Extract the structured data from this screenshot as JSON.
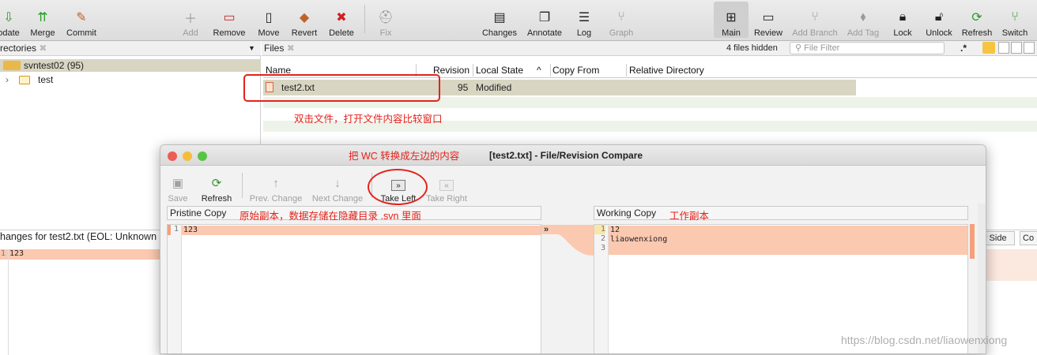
{
  "toolbar": {
    "left": [
      {
        "label": "odate",
        "icon": "update-icon"
      },
      {
        "label": "Merge",
        "icon": "merge-icon"
      },
      {
        "label": "Commit",
        "icon": "commit-icon"
      }
    ],
    "mid": [
      {
        "label": "Add",
        "icon": "add-icon",
        "disabled": true
      },
      {
        "label": "Remove",
        "icon": "remove-icon"
      },
      {
        "label": "Move",
        "icon": "move-icon"
      },
      {
        "label": "Revert",
        "icon": "revert-icon"
      },
      {
        "label": "Delete",
        "icon": "delete-icon"
      },
      {
        "label": "Fix",
        "icon": "fix-icon",
        "disabled": true
      }
    ],
    "center": [
      {
        "label": "Changes",
        "icon": "changes-icon"
      },
      {
        "label": "Annotate",
        "icon": "annotate-icon"
      },
      {
        "label": "Log",
        "icon": "log-icon"
      },
      {
        "label": "Graph",
        "icon": "graph-icon",
        "disabled": true
      }
    ],
    "right": [
      {
        "label": "Main",
        "icon": "main-view-icon",
        "selected": true
      },
      {
        "label": "Review",
        "icon": "review-icon"
      },
      {
        "label": "Add Branch",
        "icon": "add-branch-icon",
        "disabled": true
      },
      {
        "label": "Add Tag",
        "icon": "add-tag-icon",
        "disabled": true
      },
      {
        "label": "Lock",
        "icon": "lock-icon"
      },
      {
        "label": "Unlock",
        "icon": "unlock-icon"
      },
      {
        "label": "Refresh",
        "icon": "refresh-icon"
      },
      {
        "label": "Switch",
        "icon": "switch-icon"
      }
    ]
  },
  "directories": {
    "title": "rectories",
    "repo": "svntest02 (95)",
    "folder": "test"
  },
  "files": {
    "title": "Files",
    "hidden_count": "4 files hidden",
    "filter_placeholder": "File Filter",
    "regex": ".*",
    "columns": [
      "Name",
      "Revision",
      "Local State",
      "Copy From",
      "Relative Directory"
    ],
    "sort_indicator": "^",
    "rows": [
      {
        "name": "test2.txt",
        "revision": "95",
        "state": "Modified"
      }
    ]
  },
  "bottom": {
    "header": "hanges for test2.txt (EOL: Unknown",
    "line_no": "1",
    "line": "123",
    "side_btn": "y Side",
    "co_btn": "Co"
  },
  "compare": {
    "title": "[test2.txt] - File/Revision Compare",
    "toolbar": [
      {
        "label": "Save",
        "icon": "save-icon",
        "disabled": true
      },
      {
        "label": "Refresh",
        "icon": "refresh-icon"
      },
      {
        "label": "Prev. Change",
        "icon": "arrow-up-icon",
        "disabled": true
      },
      {
        "label": "Next Change",
        "icon": "arrow-down-icon",
        "disabled": true
      },
      {
        "label": "Take Left",
        "icon": "take-left-icon"
      },
      {
        "label": "Take Right",
        "icon": "take-right-icon",
        "disabled": true
      }
    ],
    "left_title": "Pristine Copy",
    "right_title": "Working Copy",
    "left_lines": [
      "123"
    ],
    "right_lines": [
      "12",
      "liaowenxiong",
      ""
    ],
    "merge_marker": "»"
  },
  "annotations": {
    "dbl_click": "双击文件，打开文件内容比较窗口",
    "take_left": "把 WC 转换成左边的内容",
    "pristine": "原始副本，数据存储在隐藏目录 .svn 里面",
    "working": "工作副本"
  },
  "watermark": "https://blog.csdn.net/liaowenxiong",
  "colors": {
    "accent": "#e3221b",
    "selection": "#d8d5c2",
    "diff": "#fbc8b0"
  }
}
